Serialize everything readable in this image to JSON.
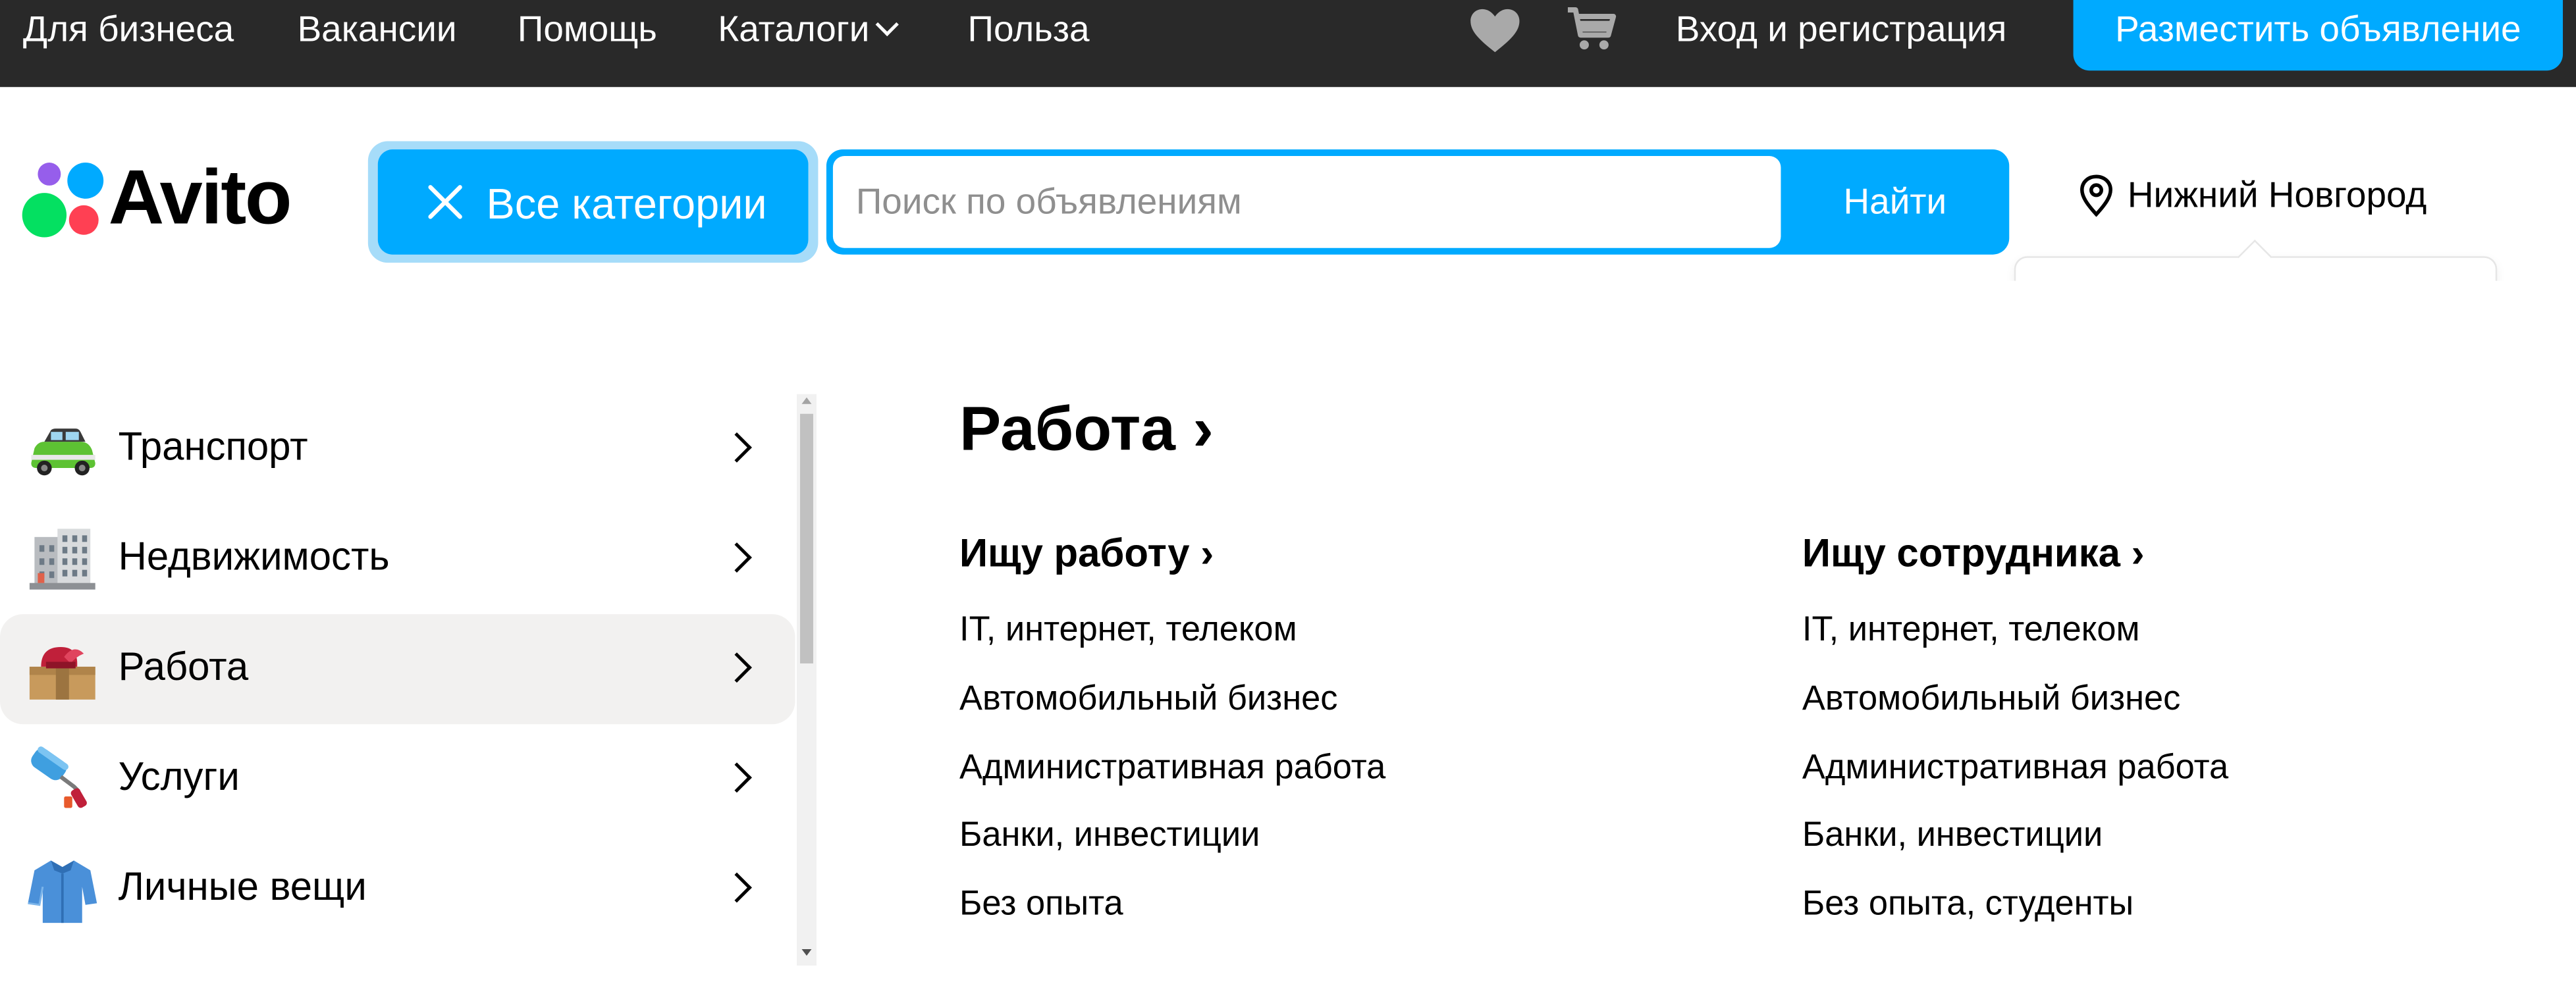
{
  "topbar": {
    "links": [
      "Для бизнеса",
      "Вакансии",
      "Помощь",
      "Каталоги",
      "Польза"
    ],
    "favorites_icon": "heart-icon",
    "cart_icon": "cart-icon",
    "login": "Вход и регистрация",
    "post_ad": "Разместить объявление"
  },
  "header": {
    "logo": "Avito",
    "logo_colors": [
      "#965eeb",
      "#04e061",
      "#ff4053",
      "#0af"
    ],
    "categories_button": "Все категории",
    "search_placeholder": "Поиск по объявлениям",
    "search_value": "",
    "find_button": "Найти",
    "city": "Нижний Новгород"
  },
  "colors": {
    "accent": "#00aaff",
    "topbar_bg": "#292929",
    "active_item_bg": "#f2f1f0"
  },
  "categories": [
    {
      "label": "Транспорт",
      "icon": "car-icon",
      "active": false
    },
    {
      "label": "Недвижимость",
      "icon": "building-icon",
      "active": false
    },
    {
      "label": "Работа",
      "icon": "work-box-icon",
      "active": true
    },
    {
      "label": "Услуги",
      "icon": "paint-roller-icon",
      "active": false
    },
    {
      "label": "Личные вещи",
      "icon": "shirt-icon",
      "active": false
    }
  ],
  "content": {
    "title": "Работа ›",
    "columns": [
      {
        "title": "Ищу работу ›",
        "items": [
          "IT, интернет, телеком",
          "Автомобильный бизнес",
          "Административная работа",
          "Банки, инвестиции",
          "Без опыта"
        ]
      },
      {
        "title": "Ищу сотрудника ›",
        "items": [
          "IT, интернет, телеком",
          "Автомобильный бизнес",
          "Административная работа",
          "Банки, инвестиции",
          "Без опыта, студенты"
        ]
      }
    ]
  }
}
